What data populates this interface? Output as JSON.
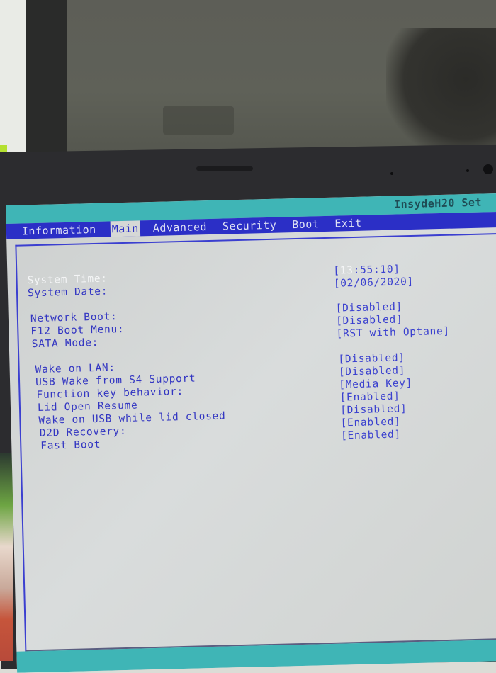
{
  "header": {
    "title": "InsydeH20 Set"
  },
  "menu": {
    "tabs": [
      {
        "label": "Information",
        "active": false
      },
      {
        "label": "Main",
        "active": true
      },
      {
        "label": "Advanced",
        "active": false
      },
      {
        "label": "Security",
        "active": false
      },
      {
        "label": "Boot",
        "active": false
      },
      {
        "label": "Exit",
        "active": false
      }
    ]
  },
  "settings": [
    {
      "label": "System Time:",
      "value_prefix": "[",
      "value_highlight": "13",
      "value_rest": ":55:10]",
      "selected": true
    },
    {
      "label": "System Date:",
      "value": "[02/06/2020]"
    },
    {
      "label": "Network Boot:",
      "value": "[Disabled]"
    },
    {
      "label": "F12 Boot Menu:",
      "value": "[Disabled]"
    },
    {
      "label": "SATA Mode:",
      "value": "[RST with Optane]"
    },
    {
      "label": "Wake on LAN:",
      "value": "[Disabled]"
    },
    {
      "label": "USB Wake from S4 Support",
      "value": "[Disabled]"
    },
    {
      "label": "Function key behavior:",
      "value": "[Media Key]"
    },
    {
      "label": "Lid Open Resume",
      "value": "[Enabled]"
    },
    {
      "label": "Wake on USB while lid closed",
      "value": "[Disabled]"
    },
    {
      "label": "D2D Recovery:",
      "value": "[Enabled]"
    },
    {
      "label": "Fast Boot",
      "value": "[Enabled]"
    }
  ],
  "colors": {
    "menu_bar": "#2b2fc6",
    "title_bar": "#3fb5b6",
    "text_blue": "#3336c2",
    "selected_text": "#f4f5f6",
    "screen_bg": "#d6d8d6"
  }
}
